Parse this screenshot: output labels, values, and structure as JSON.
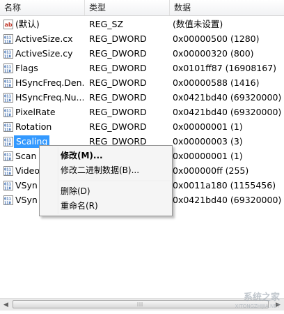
{
  "columns": {
    "name": "名称",
    "type": "类型",
    "data": "数据"
  },
  "rows": [
    {
      "name": "(默认)",
      "type": "REG_SZ",
      "data": "(数值未设置)",
      "icon": "string"
    },
    {
      "name": "ActiveSize.cx",
      "type": "REG_DWORD",
      "data": "0x00000500 (1280)",
      "icon": "binary"
    },
    {
      "name": "ActiveSize.cy",
      "type": "REG_DWORD",
      "data": "0x00000320 (800)",
      "icon": "binary"
    },
    {
      "name": "Flags",
      "type": "REG_DWORD",
      "data": "0x0101ff87 (16908167)",
      "icon": "binary"
    },
    {
      "name": "HSyncFreq.Den...",
      "type": "REG_DWORD",
      "data": "0x00000588 (1416)",
      "icon": "binary"
    },
    {
      "name": "HSyncFreq.Nu...",
      "type": "REG_DWORD",
      "data": "0x0421bd40 (69320000)",
      "icon": "binary"
    },
    {
      "name": "PixelRate",
      "type": "REG_DWORD",
      "data": "0x0421bd40 (69320000)",
      "icon": "binary"
    },
    {
      "name": "Rotation",
      "type": "REG_DWORD",
      "data": "0x00000001 (1)",
      "icon": "binary"
    },
    {
      "name": "Scaling",
      "type": "REG_DWORD",
      "data": "0x00000003 (3)",
      "icon": "binary",
      "selected": true
    },
    {
      "name": "Scan",
      "type": "",
      "data": "0x00000001 (1)",
      "icon": "binary"
    },
    {
      "name": "Video",
      "type": "",
      "data": "0x000000ff (255)",
      "icon": "binary"
    },
    {
      "name": "VSyn",
      "type": "",
      "data": "0x0011a180 (1155456)",
      "icon": "binary"
    },
    {
      "name": "VSyn",
      "type": "",
      "data": "0x0421bd40 (69320000)",
      "icon": "binary"
    }
  ],
  "context_menu": {
    "modify": "修改(M)...",
    "modify_binary": "修改二进制数据(B)...",
    "delete": "删除(D)",
    "rename": "重命名(R)"
  },
  "watermark": {
    "text": "系统之家",
    "sub": "XITONGZHIJIA.NET"
  },
  "colors": {
    "selection": "#3399ff",
    "icon_blue": "#2b5fa8",
    "icon_red": "#c0392b"
  }
}
